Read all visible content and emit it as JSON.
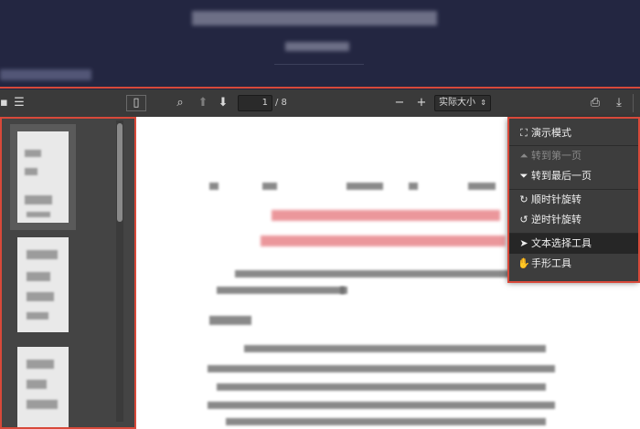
{
  "toolbar": {
    "sidebar_toggle_icon": "sidebar-toggle-icon",
    "search_icon": "search-icon",
    "prev_page_icon": "arrow-up-icon",
    "next_page_icon": "arrow-down-icon",
    "page_current": "1",
    "page_total": "/ 8",
    "zoom_out": "−",
    "zoom_in": "+",
    "zoom_value": "实际大小",
    "print_icon": "print-icon",
    "download_icon": "download-icon"
  },
  "menu": {
    "items": [
      {
        "label": "演示模式",
        "icon": "presentation-icon",
        "enabled": true
      },
      {
        "label": "转到第一页",
        "icon": "first-page-icon",
        "enabled": false
      },
      {
        "label": "转到最后一页",
        "icon": "last-page-icon",
        "enabled": true
      },
      {
        "label": "顺时针旋转",
        "icon": "rotate-cw-icon",
        "enabled": true
      },
      {
        "label": "逆时针旋转",
        "icon": "rotate-ccw-icon",
        "enabled": true
      },
      {
        "label": "文本选择工具",
        "icon": "cursor-icon",
        "enabled": true,
        "selected": true
      },
      {
        "label": "手形工具",
        "icon": "hand-icon",
        "enabled": true
      }
    ]
  },
  "colors": {
    "highlight_border": "#d8493a",
    "toolbar_bg": "#3a3a3a",
    "banner_bg": "#232641"
  }
}
